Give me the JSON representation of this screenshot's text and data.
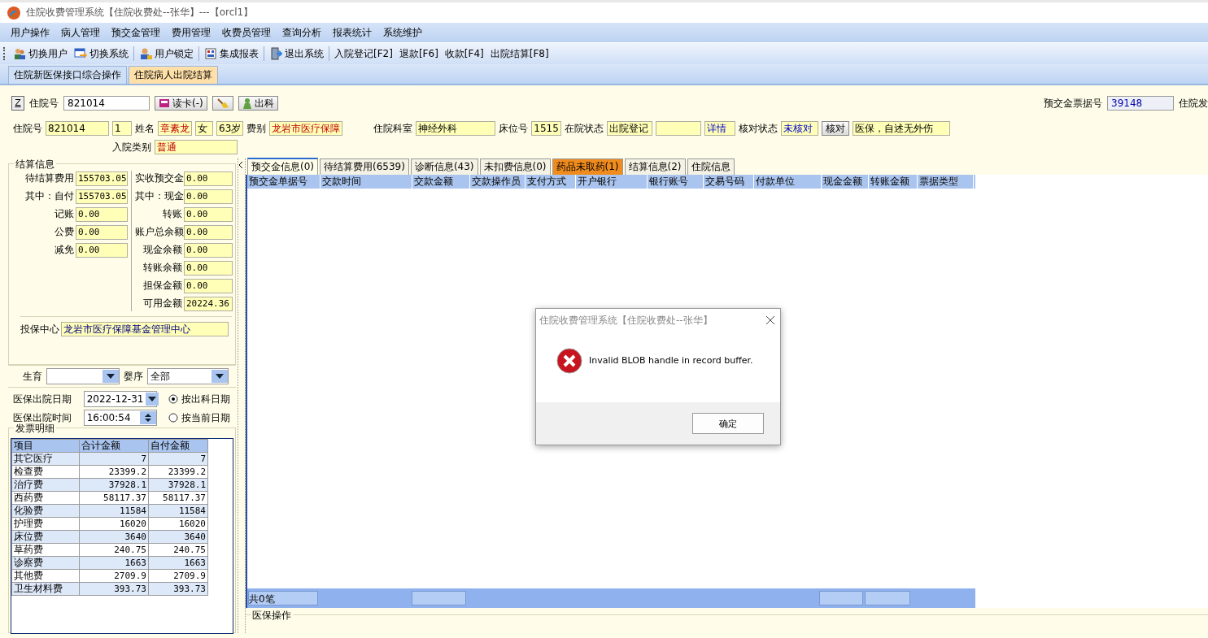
{
  "window": {
    "title": "住院收费管理系统【住院收费处--张华】---【orcl1】"
  },
  "menu": [
    "用户操作",
    "病人管理",
    "预交金管理",
    "费用管理",
    "收费员管理",
    "查询分析",
    "报表统计",
    "系统维护"
  ],
  "toolbar": [
    {
      "label": "切换用户",
      "kind": "icon",
      "group_end": false
    },
    {
      "label": "切换系统",
      "kind": "icon",
      "group_end": true
    },
    {
      "label": "用户锁定",
      "kind": "icon",
      "group_end": true
    },
    {
      "label": "集成报表",
      "kind": "icon",
      "group_end": true
    },
    {
      "label": "退出系统",
      "kind": "icon",
      "group_end": true
    },
    {
      "label": "入院登记[F2]",
      "kind": "text",
      "group_end": false
    },
    {
      "label": "退款[F6]",
      "kind": "text",
      "group_end": false
    },
    {
      "label": "收款[F4]",
      "kind": "text",
      "group_end": false
    },
    {
      "label": "出院结算[F8]",
      "kind": "text",
      "group_end": false
    }
  ],
  "doc_tabs": [
    {
      "label": "住院新医保接口综合操作",
      "selected": false
    },
    {
      "label": "住院病人出院结算",
      "selected": true
    }
  ],
  "search_row": {
    "z_button": "Z",
    "id_label": "住院号",
    "id_value": "821014",
    "read_card": "读卡(-)",
    "discharge": "出科",
    "receipt_label": "预交金票据号",
    "receipt_value": "39148",
    "cut_label": "住院发"
  },
  "patient": [
    {
      "kind": "label",
      "text": "住院号"
    },
    {
      "kind": "field",
      "text": "821014",
      "alert": false,
      "link": false
    },
    {
      "kind": "field",
      "text": "1",
      "alert": false,
      "link": false
    },
    {
      "kind": "label",
      "text": "姓名"
    },
    {
      "kind": "field",
      "text": "章素龙",
      "alert": true,
      "link": false
    },
    {
      "kind": "field",
      "text": "女",
      "alert": false,
      "link": false
    },
    {
      "kind": "field",
      "text": "63岁",
      "alert": false,
      "link": false
    },
    {
      "kind": "label",
      "text": "费别"
    },
    {
      "kind": "field",
      "text": "龙岩市医疗保障",
      "alert": true,
      "link": false
    },
    {
      "kind": "gap"
    },
    {
      "kind": "label",
      "text": "住院科室"
    },
    {
      "kind": "field",
      "text": "神经外科",
      "alert": false,
      "link": false
    },
    {
      "kind": "label",
      "text": "床位号"
    },
    {
      "kind": "field",
      "text": "1515",
      "alert": false,
      "link": false
    },
    {
      "kind": "label",
      "text": "在院状态"
    },
    {
      "kind": "field",
      "text": "出院登记",
      "alert": false,
      "link": false
    },
    {
      "kind": "field"
    },
    {
      "kind": "field",
      "text": "详情",
      "alert": false,
      "link": true
    },
    {
      "kind": "label",
      "text": "核对状态"
    },
    {
      "kind": "field",
      "text": "未核对",
      "alert": false,
      "link": true
    },
    {
      "kind": "button",
      "text": "核对"
    },
    {
      "kind": "field",
      "text": "医保，自述无外伤",
      "alert": false,
      "link": false
    }
  ],
  "admission": {
    "label": "入院类别",
    "value": "普通",
    "alert": true
  },
  "settlement": {
    "title": "结算信息",
    "left": [
      {
        "label": "待结算费用",
        "value": "155703.05"
      },
      {
        "label": "其中：自付",
        "value": "155703.05"
      },
      {
        "label": "记账",
        "value": "0.00"
      },
      {
        "label": "公费",
        "value": "0.00"
      },
      {
        "label": "减免",
        "value": "0.00"
      }
    ],
    "right": [
      {
        "label": "实收预交金",
        "value": "0.00"
      },
      {
        "label": "其中：现金",
        "value": "0.00"
      },
      {
        "label": "转账",
        "value": "0.00"
      },
      {
        "label": "账户总余额",
        "value": "0.00"
      },
      {
        "label": "现金余额",
        "value": "0.00"
      },
      {
        "label": "转账余额",
        "value": "0.00"
      },
      {
        "label": "担保金额",
        "value": "0.00"
      },
      {
        "label": "可用金额",
        "value": "20224.36"
      }
    ],
    "insurer": {
      "label": "投保中心",
      "value": "龙岩市医疗保障基金管理中心"
    }
  },
  "birth": {
    "label": "生育"
  },
  "infant_order": {
    "label": "婴序",
    "value": "全部"
  },
  "discharge_date": {
    "label": "医保出院日期",
    "value": "2022-12-31"
  },
  "discharge_time": {
    "label": "医保出院时间",
    "value": "16:00:54"
  },
  "date_mode": [
    {
      "label": "按出科日期",
      "selected": true
    },
    {
      "label": "按当前日期",
      "selected": false
    }
  ],
  "invoice": {
    "title": "发票明细",
    "columns": [
      "项目",
      "合计金额",
      "自付金额"
    ],
    "rows": [
      [
        "其它医疗",
        "7",
        "7"
      ],
      [
        "检查费",
        "23399.2",
        "23399.2"
      ],
      [
        "治疗费",
        "37928.1",
        "37928.1"
      ],
      [
        "西药费",
        "58117.37",
        "58117.37"
      ],
      [
        "化验费",
        "11584",
        "11584"
      ],
      [
        "护理费",
        "16020",
        "16020"
      ],
      [
        "床位费",
        "3640",
        "3640"
      ],
      [
        "草药费",
        "240.75",
        "240.75"
      ],
      [
        "诊察费",
        "1663",
        "1663"
      ],
      [
        "其他费",
        "2709.9",
        "2709.9"
      ],
      [
        "卫生材料费",
        "393.73",
        "393.73"
      ]
    ]
  },
  "tabs": [
    {
      "label": "预交金信息(0)",
      "selected": true,
      "alert": false
    },
    {
      "label": "待结算费用(6539)",
      "selected": false,
      "alert": false
    },
    {
      "label": "诊断信息(43)",
      "selected": false,
      "alert": false
    },
    {
      "label": "未扣费信息(0)",
      "selected": false,
      "alert": false
    },
    {
      "label": "药品未取药(1)",
      "selected": false,
      "alert": true
    },
    {
      "label": "结算信息(2)",
      "selected": false,
      "alert": false
    },
    {
      "label": "住院信息",
      "selected": false,
      "alert": false
    }
  ],
  "table": {
    "columns": [
      "预交金单据号",
      "交款时间",
      "交款金额",
      "交款操作员",
      "支付方式",
      "开户银行",
      "银行账号",
      "交易号码",
      "付款单位",
      "现金金额",
      "转账金额",
      "票据类型"
    ],
    "footer": "共0笔"
  },
  "insurance_ops": {
    "title": "医保操作"
  },
  "dialog": {
    "title": "住院收费管理系统【住院收费处--张华】",
    "message": "Invalid BLOB handle in record buffer.",
    "button": "确定"
  }
}
